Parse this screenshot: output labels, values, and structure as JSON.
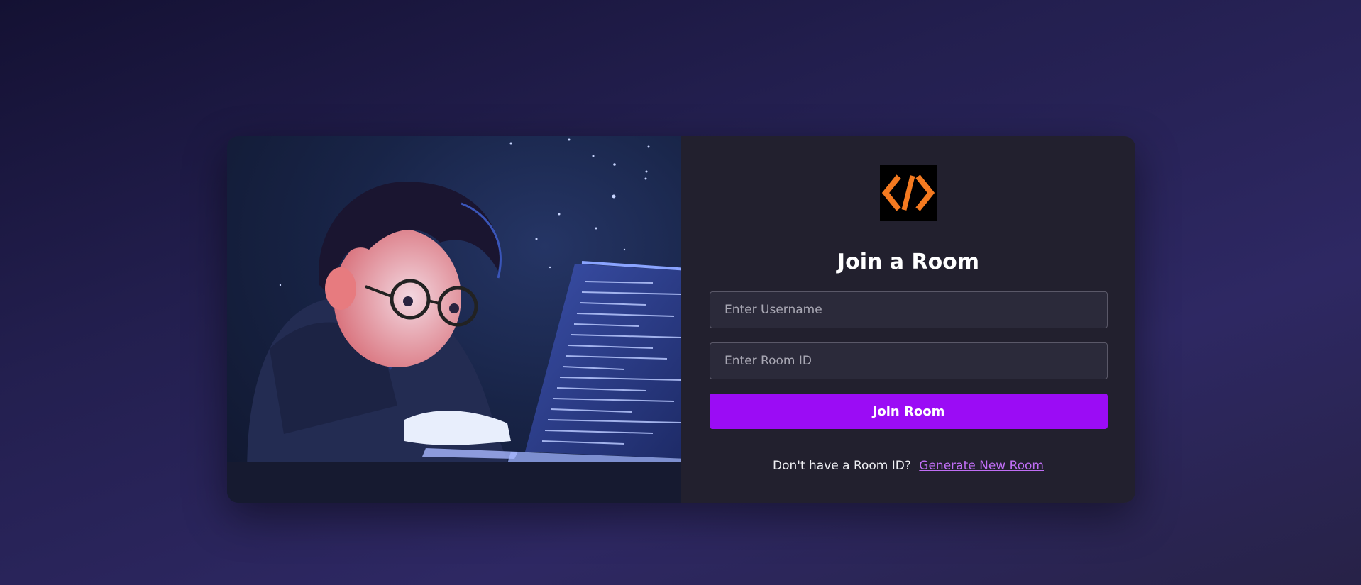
{
  "form": {
    "title": "Join a Room",
    "username_placeholder": "Enter Username",
    "room_id_placeholder": "Enter Room ID",
    "join_button_label": "Join Room",
    "prompt_text": "Don't have a Room ID?",
    "generate_link_label": "Generate New Room"
  },
  "logo": {
    "icon": "code-icon",
    "color": "#f47a20",
    "background": "#000000"
  },
  "colors": {
    "accent": "#9b0cf5",
    "link": "#c06ef5",
    "panel": "#22202e"
  }
}
